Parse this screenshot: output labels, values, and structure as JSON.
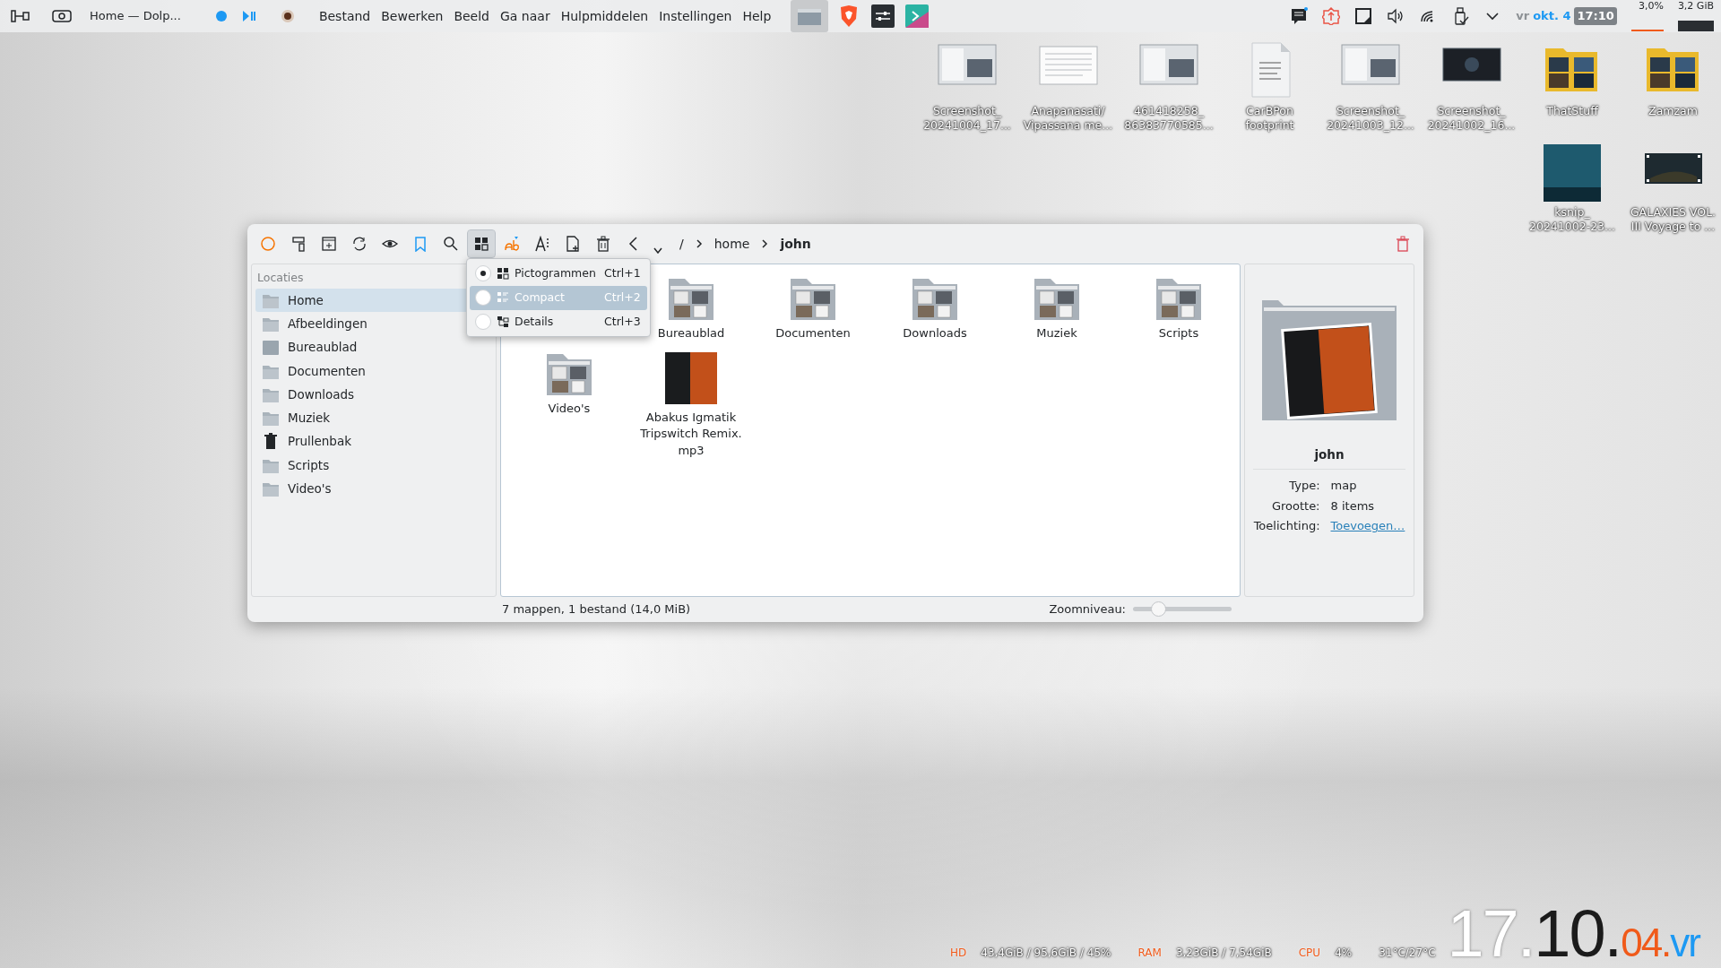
{
  "panel": {
    "app_title": "Home — Dolp...",
    "menus": [
      "Bestand",
      "Bewerken",
      "Beeld",
      "Ga naar",
      "Hulpmiddelen",
      "Instellingen",
      "Help"
    ],
    "clock": {
      "day": "vr",
      "date": "okt. 4",
      "time": "17:10"
    },
    "cpu": "3,0%",
    "memory": "3,2 GiB"
  },
  "desktop_icons": [
    {
      "label": "Screenshot_\n20241004_17...",
      "kind": "image"
    },
    {
      "label": "Anapanasati/\nVipassana me...",
      "kind": "document-image"
    },
    {
      "label": "461418258_\n86383770585...",
      "kind": "image"
    },
    {
      "label": "CarBPon\nfootprint",
      "kind": "text-file"
    },
    {
      "label": "Screenshot_\n20241003_12...",
      "kind": "image"
    },
    {
      "label": "Screenshot_\n20241002_16...",
      "kind": "dark-image"
    },
    {
      "label": "ThatStuff",
      "kind": "folder"
    },
    {
      "label": "Zamzam",
      "kind": "folder"
    },
    {
      "label": "ksnip_\n20241002-23...",
      "kind": "image"
    },
    {
      "label": "GALAXIES VOL.\nIII  Voyage to ...",
      "kind": "video"
    }
  ],
  "window": {
    "breadcrumbs": [
      "/",
      "home",
      "john"
    ],
    "places": {
      "title": "Locaties",
      "items": [
        {
          "label": "Home",
          "selected": true,
          "kind": "folder"
        },
        {
          "label": "Afbeeldingen",
          "selected": false,
          "kind": "folder"
        },
        {
          "label": "Bureaublad",
          "selected": false,
          "kind": "desktop"
        },
        {
          "label": "Documenten",
          "selected": false,
          "kind": "folder"
        },
        {
          "label": "Downloads",
          "selected": false,
          "kind": "folder"
        },
        {
          "label": "Muziek",
          "selected": false,
          "kind": "folder"
        },
        {
          "label": "Prullenbak",
          "selected": false,
          "kind": "trash"
        },
        {
          "label": "Scripts",
          "selected": false,
          "kind": "folder"
        },
        {
          "label": "Video's",
          "selected": false,
          "kind": "folder"
        }
      ]
    },
    "view_menu": [
      {
        "label": "Pictogrammen",
        "shortcut": "Ctrl+1",
        "checked": true,
        "highlighted": false
      },
      {
        "label": "Compact",
        "shortcut": "Ctrl+2",
        "checked": false,
        "highlighted": true
      },
      {
        "label": "Details",
        "shortcut": "Ctrl+3",
        "checked": false,
        "highlighted": false
      }
    ],
    "files": [
      {
        "label": "Bureaublad",
        "kind": "folder"
      },
      {
        "label": "Documenten",
        "kind": "folder"
      },
      {
        "label": "Downloads",
        "kind": "folder"
      },
      {
        "label": "Muziek",
        "kind": "folder"
      },
      {
        "label": "Scripts",
        "kind": "folder"
      },
      {
        "label": "Video's",
        "kind": "folder"
      },
      {
        "label": "Abakus Igmatik Tripswitch Remix.\nmp3",
        "kind": "audio"
      }
    ],
    "status": "7 mappen, 1 bestand (14,0 MiB)",
    "zoom": {
      "label": "Zoomniveau:",
      "level": 0.25
    },
    "info": {
      "name": "john",
      "fields": [
        {
          "label": "Type:",
          "value": "map"
        },
        {
          "label": "Grootte:",
          "value": "8 items"
        },
        {
          "label": "Toelichting:",
          "link": "Toevoegen…"
        }
      ]
    }
  },
  "system_stats": [
    {
      "label": "HD",
      "value": "43,4GiB / 95,6GiB / 45%"
    },
    {
      "label": "RAM",
      "value": "3,23GiB / 7,54GiB"
    },
    {
      "label": "CPU",
      "value": "4%"
    },
    {
      "value": "31°C/27°C"
    }
  ],
  "big_clock": [
    {
      "text": "17.",
      "color": "#ffffff"
    },
    {
      "text": "10.",
      "color": "#1b1b1b"
    },
    {
      "text": "04.",
      "color": "#f05a1a"
    },
    {
      "text": "vr",
      "color": "#1d99f3"
    }
  ]
}
